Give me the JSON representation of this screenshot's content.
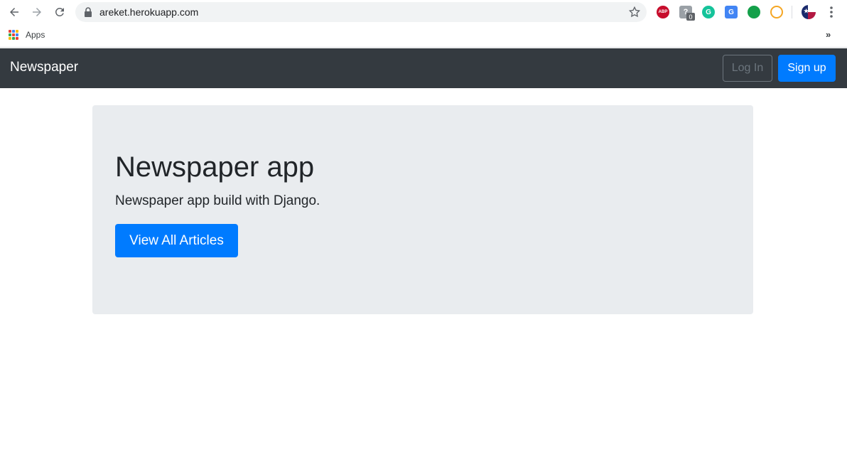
{
  "browser": {
    "url": "areket.herokuapp.com",
    "icons": {
      "back": "back-arrow-icon",
      "forward": "forward-arrow-icon",
      "reload": "reload-icon",
      "lock": "lock-icon",
      "bookmark": "star-icon",
      "menu": "menu-dots-icon"
    },
    "extensions": [
      {
        "name": "adblock-plus-icon",
        "text": "ABP",
        "color": "#c70d2c"
      },
      {
        "name": "unknown-extension-icon",
        "text": "?",
        "badge": "0",
        "color": "#5f6368"
      },
      {
        "name": "grammarly-icon",
        "text": "G",
        "color": "#15c39a"
      },
      {
        "name": "google-translate-icon",
        "text": "G",
        "color": "#4285f4"
      },
      {
        "name": "evernote-icon",
        "text": "",
        "color": "#14a04a"
      },
      {
        "name": "honey-icon",
        "text": "",
        "color": "#f5a623"
      },
      {
        "name": "profile-avatar-icon",
        "text": "",
        "color": "#1a2a6c"
      }
    ]
  },
  "bookmarks": {
    "apps_label": "Apps",
    "more": "»"
  },
  "navbar": {
    "brand": "Newspaper",
    "login_label": "Log In",
    "signup_label": "Sign up"
  },
  "jumbotron": {
    "title": "Newspaper app",
    "lead": "Newspaper app build with Django.",
    "button_label": "View All Articles"
  },
  "colors": {
    "navbar_bg": "#343a40",
    "primary": "#007bff",
    "jumbotron_bg": "#e9ecef"
  }
}
